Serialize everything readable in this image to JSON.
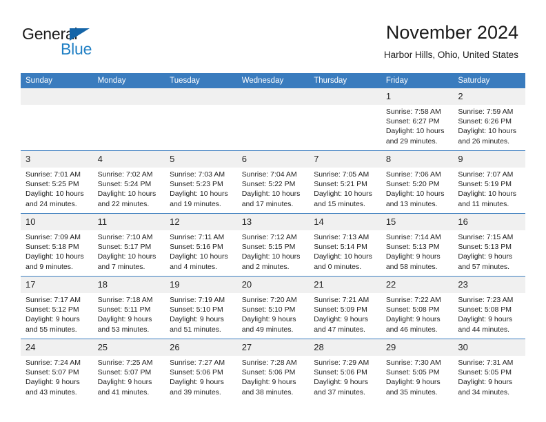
{
  "brand": {
    "word1": "General",
    "word2": "Blue",
    "triangle_color": "#1565a8",
    "blue_text_color": "#1f7fc4"
  },
  "header": {
    "title": "November 2024",
    "subtitle": "Harbor Hills, Ohio, United States",
    "header_bg": "#3a7cbe",
    "header_text_color": "#ffffff",
    "daynum_bg": "#f0f0f0"
  },
  "weekday_headers": [
    "Sunday",
    "Monday",
    "Tuesday",
    "Wednesday",
    "Thursday",
    "Friday",
    "Saturday"
  ],
  "weeks": [
    [
      {
        "day": "",
        "empty": true,
        "sunrise": "",
        "sunset": "",
        "daylight1": "",
        "daylight2": ""
      },
      {
        "day": "",
        "empty": true,
        "sunrise": "",
        "sunset": "",
        "daylight1": "",
        "daylight2": ""
      },
      {
        "day": "",
        "empty": true,
        "sunrise": "",
        "sunset": "",
        "daylight1": "",
        "daylight2": ""
      },
      {
        "day": "",
        "empty": true,
        "sunrise": "",
        "sunset": "",
        "daylight1": "",
        "daylight2": ""
      },
      {
        "day": "",
        "empty": true,
        "sunrise": "",
        "sunset": "",
        "daylight1": "",
        "daylight2": ""
      },
      {
        "day": "1",
        "empty": false,
        "sunrise": "Sunrise: 7:58 AM",
        "sunset": "Sunset: 6:27 PM",
        "daylight1": "Daylight: 10 hours",
        "daylight2": "and 29 minutes."
      },
      {
        "day": "2",
        "empty": false,
        "sunrise": "Sunrise: 7:59 AM",
        "sunset": "Sunset: 6:26 PM",
        "daylight1": "Daylight: 10 hours",
        "daylight2": "and 26 minutes."
      }
    ],
    [
      {
        "day": "3",
        "empty": false,
        "sunrise": "Sunrise: 7:01 AM",
        "sunset": "Sunset: 5:25 PM",
        "daylight1": "Daylight: 10 hours",
        "daylight2": "and 24 minutes."
      },
      {
        "day": "4",
        "empty": false,
        "sunrise": "Sunrise: 7:02 AM",
        "sunset": "Sunset: 5:24 PM",
        "daylight1": "Daylight: 10 hours",
        "daylight2": "and 22 minutes."
      },
      {
        "day": "5",
        "empty": false,
        "sunrise": "Sunrise: 7:03 AM",
        "sunset": "Sunset: 5:23 PM",
        "daylight1": "Daylight: 10 hours",
        "daylight2": "and 19 minutes."
      },
      {
        "day": "6",
        "empty": false,
        "sunrise": "Sunrise: 7:04 AM",
        "sunset": "Sunset: 5:22 PM",
        "daylight1": "Daylight: 10 hours",
        "daylight2": "and 17 minutes."
      },
      {
        "day": "7",
        "empty": false,
        "sunrise": "Sunrise: 7:05 AM",
        "sunset": "Sunset: 5:21 PM",
        "daylight1": "Daylight: 10 hours",
        "daylight2": "and 15 minutes."
      },
      {
        "day": "8",
        "empty": false,
        "sunrise": "Sunrise: 7:06 AM",
        "sunset": "Sunset: 5:20 PM",
        "daylight1": "Daylight: 10 hours",
        "daylight2": "and 13 minutes."
      },
      {
        "day": "9",
        "empty": false,
        "sunrise": "Sunrise: 7:07 AM",
        "sunset": "Sunset: 5:19 PM",
        "daylight1": "Daylight: 10 hours",
        "daylight2": "and 11 minutes."
      }
    ],
    [
      {
        "day": "10",
        "empty": false,
        "sunrise": "Sunrise: 7:09 AM",
        "sunset": "Sunset: 5:18 PM",
        "daylight1": "Daylight: 10 hours",
        "daylight2": "and 9 minutes."
      },
      {
        "day": "11",
        "empty": false,
        "sunrise": "Sunrise: 7:10 AM",
        "sunset": "Sunset: 5:17 PM",
        "daylight1": "Daylight: 10 hours",
        "daylight2": "and 7 minutes."
      },
      {
        "day": "12",
        "empty": false,
        "sunrise": "Sunrise: 7:11 AM",
        "sunset": "Sunset: 5:16 PM",
        "daylight1": "Daylight: 10 hours",
        "daylight2": "and 4 minutes."
      },
      {
        "day": "13",
        "empty": false,
        "sunrise": "Sunrise: 7:12 AM",
        "sunset": "Sunset: 5:15 PM",
        "daylight1": "Daylight: 10 hours",
        "daylight2": "and 2 minutes."
      },
      {
        "day": "14",
        "empty": false,
        "sunrise": "Sunrise: 7:13 AM",
        "sunset": "Sunset: 5:14 PM",
        "daylight1": "Daylight: 10 hours",
        "daylight2": "and 0 minutes."
      },
      {
        "day": "15",
        "empty": false,
        "sunrise": "Sunrise: 7:14 AM",
        "sunset": "Sunset: 5:13 PM",
        "daylight1": "Daylight: 9 hours",
        "daylight2": "and 58 minutes."
      },
      {
        "day": "16",
        "empty": false,
        "sunrise": "Sunrise: 7:15 AM",
        "sunset": "Sunset: 5:13 PM",
        "daylight1": "Daylight: 9 hours",
        "daylight2": "and 57 minutes."
      }
    ],
    [
      {
        "day": "17",
        "empty": false,
        "sunrise": "Sunrise: 7:17 AM",
        "sunset": "Sunset: 5:12 PM",
        "daylight1": "Daylight: 9 hours",
        "daylight2": "and 55 minutes."
      },
      {
        "day": "18",
        "empty": false,
        "sunrise": "Sunrise: 7:18 AM",
        "sunset": "Sunset: 5:11 PM",
        "daylight1": "Daylight: 9 hours",
        "daylight2": "and 53 minutes."
      },
      {
        "day": "19",
        "empty": false,
        "sunrise": "Sunrise: 7:19 AM",
        "sunset": "Sunset: 5:10 PM",
        "daylight1": "Daylight: 9 hours",
        "daylight2": "and 51 minutes."
      },
      {
        "day": "20",
        "empty": false,
        "sunrise": "Sunrise: 7:20 AM",
        "sunset": "Sunset: 5:10 PM",
        "daylight1": "Daylight: 9 hours",
        "daylight2": "and 49 minutes."
      },
      {
        "day": "21",
        "empty": false,
        "sunrise": "Sunrise: 7:21 AM",
        "sunset": "Sunset: 5:09 PM",
        "daylight1": "Daylight: 9 hours",
        "daylight2": "and 47 minutes."
      },
      {
        "day": "22",
        "empty": false,
        "sunrise": "Sunrise: 7:22 AM",
        "sunset": "Sunset: 5:08 PM",
        "daylight1": "Daylight: 9 hours",
        "daylight2": "and 46 minutes."
      },
      {
        "day": "23",
        "empty": false,
        "sunrise": "Sunrise: 7:23 AM",
        "sunset": "Sunset: 5:08 PM",
        "daylight1": "Daylight: 9 hours",
        "daylight2": "and 44 minutes."
      }
    ],
    [
      {
        "day": "24",
        "empty": false,
        "sunrise": "Sunrise: 7:24 AM",
        "sunset": "Sunset: 5:07 PM",
        "daylight1": "Daylight: 9 hours",
        "daylight2": "and 43 minutes."
      },
      {
        "day": "25",
        "empty": false,
        "sunrise": "Sunrise: 7:25 AM",
        "sunset": "Sunset: 5:07 PM",
        "daylight1": "Daylight: 9 hours",
        "daylight2": "and 41 minutes."
      },
      {
        "day": "26",
        "empty": false,
        "sunrise": "Sunrise: 7:27 AM",
        "sunset": "Sunset: 5:06 PM",
        "daylight1": "Daylight: 9 hours",
        "daylight2": "and 39 minutes."
      },
      {
        "day": "27",
        "empty": false,
        "sunrise": "Sunrise: 7:28 AM",
        "sunset": "Sunset: 5:06 PM",
        "daylight1": "Daylight: 9 hours",
        "daylight2": "and 38 minutes."
      },
      {
        "day": "28",
        "empty": false,
        "sunrise": "Sunrise: 7:29 AM",
        "sunset": "Sunset: 5:06 PM",
        "daylight1": "Daylight: 9 hours",
        "daylight2": "and 37 minutes."
      },
      {
        "day": "29",
        "empty": false,
        "sunrise": "Sunrise: 7:30 AM",
        "sunset": "Sunset: 5:05 PM",
        "daylight1": "Daylight: 9 hours",
        "daylight2": "and 35 minutes."
      },
      {
        "day": "30",
        "empty": false,
        "sunrise": "Sunrise: 7:31 AM",
        "sunset": "Sunset: 5:05 PM",
        "daylight1": "Daylight: 9 hours",
        "daylight2": "and 34 minutes."
      }
    ]
  ]
}
